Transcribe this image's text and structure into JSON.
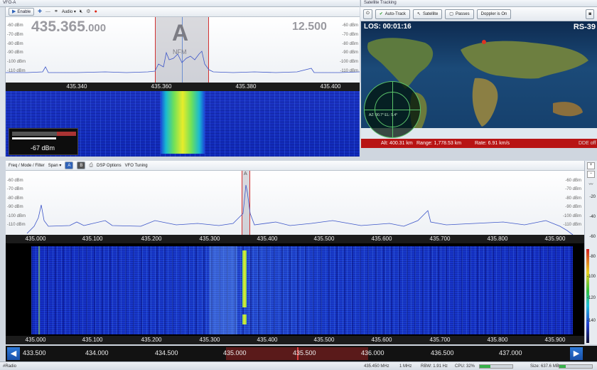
{
  "vfo_panel": {
    "title": "VFO-A",
    "enable_label": "Enable",
    "audio_label": "Audio",
    "frequency_main": "435.365",
    "frequency_sub": ".000",
    "bandwidth": "12.500",
    "vfo_letter": "A",
    "mode": "NFM",
    "db_labels": [
      "-60 dBm",
      "-70 dBm",
      "-80 dBm",
      "-90 dBm",
      "-100 dBm",
      "-110 dBm"
    ],
    "freq_ticks": [
      "435.340",
      "435.360",
      "435.380",
      "435.400"
    ],
    "smeter_value": "-67 dBm"
  },
  "satellite": {
    "title": "Satellite Tracking",
    "buttons": {
      "autotrack": "Auto-Track",
      "satellite": "Satellite",
      "passes": "Passes",
      "doppler": "Doppler is On"
    },
    "los": "LOS: 00:01:16",
    "name": "RS-39",
    "radar_az": "AZ: 90.7°",
    "radar_el": "EL: 5.4°",
    "alt": "Alt: 400.31 km",
    "range": "Range: 1,778.53 km",
    "rate": "Rate: 6.91 km/s",
    "dde": "DDE off"
  },
  "main_panel": {
    "tabs": [
      "Freq / Mode / Filter",
      "Span",
      "DSP Options",
      "VFO Tuning"
    ],
    "vfo_a": "A",
    "vfo_b": "B",
    "db_labels": [
      "-60 dBm",
      "-70 dBm",
      "-80 dBm",
      "-90 dBm",
      "-100 dBm",
      "-110 dBm"
    ],
    "freq_ticks": [
      "435.000",
      "435.100",
      "435.200",
      "435.300",
      "435.400",
      "435.500",
      "435.600",
      "435.700",
      "435.800",
      "435.900"
    ],
    "vfo_marker": "A"
  },
  "band_scale": [
    "433.500",
    "434.000",
    "434.500",
    "435.000",
    "435.500",
    "436.000",
    "436.500",
    "437.000"
  ],
  "right_scale": [
    "-20",
    "-40",
    "-60",
    "-80",
    "-100",
    "-120",
    "-140"
  ],
  "status": {
    "left": "#Radio",
    "freq": "435.450 MHz",
    "sr": "1 MHz",
    "rbw": "RBW: 1.91 Hz",
    "cpu": "CPU: 32%",
    "size": "Size: 637.6 MB"
  },
  "colors": {
    "accent": "#3063b8",
    "waterfall_bg": "#1029b8",
    "sat_bar": "#b81414",
    "vfo_line": "#d23232"
  }
}
